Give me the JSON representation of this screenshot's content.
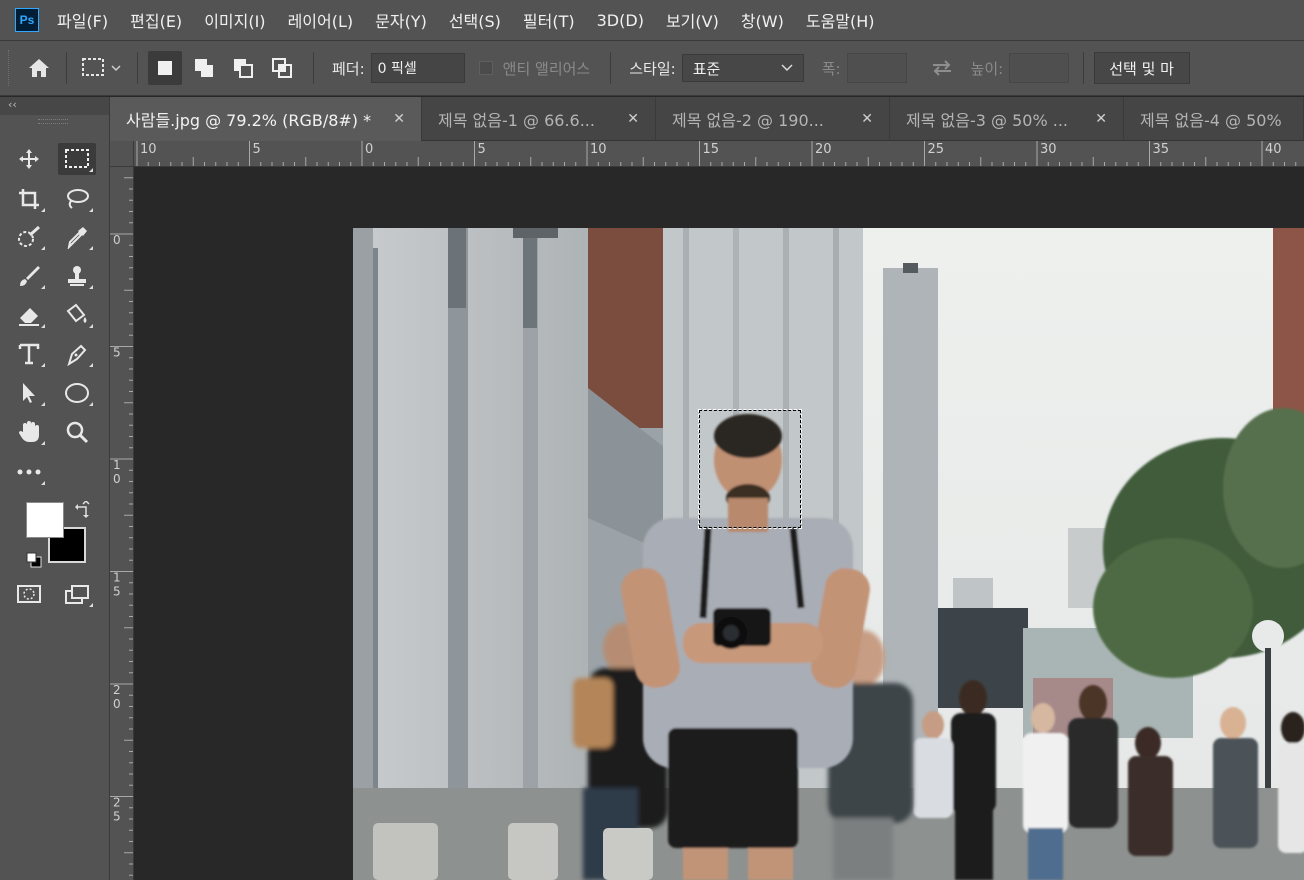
{
  "app": {
    "logo": "Ps"
  },
  "menu": [
    "파일(F)",
    "편집(E)",
    "이미지(I)",
    "레이어(L)",
    "문자(Y)",
    "선택(S)",
    "필터(T)",
    "3D(D)",
    "보기(V)",
    "창(W)",
    "도움말(H)"
  ],
  "options": {
    "feather_label": "페더:",
    "feather_value": "0 픽셀",
    "antialias_label": "앤티 앨리어스",
    "style_label": "스타일:",
    "style_value": "표준",
    "width_label": "폭:",
    "height_label": "높이:",
    "select_mask_label": "선택 및 마"
  },
  "toolbar": {
    "collapse": "‹‹"
  },
  "tabs": [
    {
      "label": "사람들.jpg @ 79.2% (RGB/8#) *",
      "active": true
    },
    {
      "label": "제목 없음-1 @ 66.6...",
      "active": false
    },
    {
      "label": "제목 없음-2 @ 190...",
      "active": false
    },
    {
      "label": "제목 없음-3 @ 50% ...",
      "active": false
    },
    {
      "label": "제목 없음-4 @ 50%",
      "active": false
    }
  ],
  "ruler": {
    "h_labels": [
      "10",
      "5",
      "0",
      "5",
      "10",
      "15",
      "20",
      "25",
      "30",
      "35",
      "40"
    ],
    "v_labels": [
      [
        "0"
      ],
      [
        "5"
      ],
      [
        "1",
        "0"
      ],
      [
        "1",
        "5"
      ],
      [
        "2",
        "0"
      ],
      [
        "2",
        "5"
      ]
    ]
  },
  "colors": {
    "foreground": "#ffffff",
    "background": "#000000",
    "accent": "#31a8ff"
  }
}
